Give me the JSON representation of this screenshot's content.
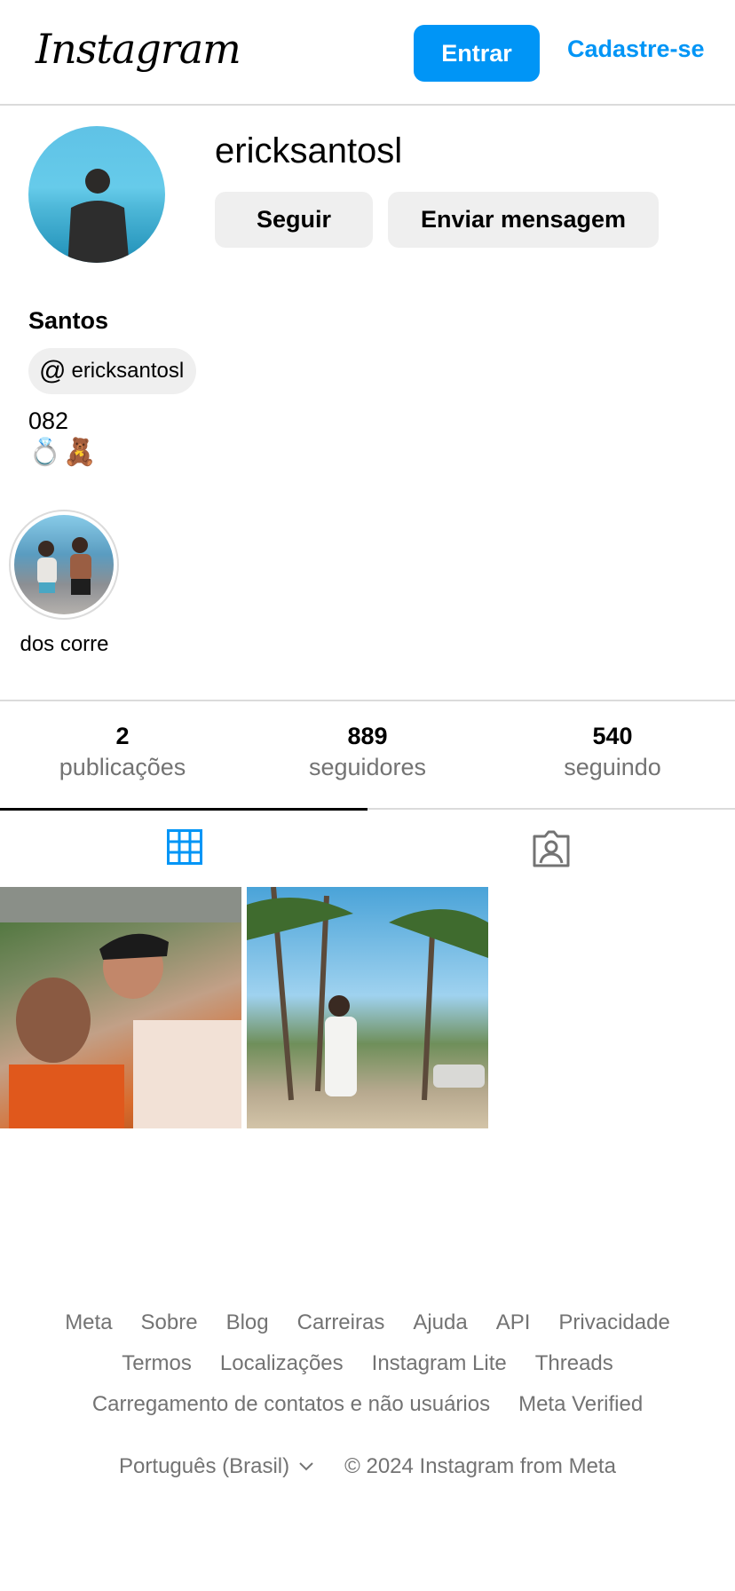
{
  "header": {
    "logo": "Instagram",
    "login_label": "Entrar",
    "signup_label": "Cadastre-se"
  },
  "profile": {
    "username": "ericksantosl",
    "follow_label": "Seguir",
    "message_label": "Enviar mensagem",
    "full_name": "Santos",
    "threads_handle": "ericksantosl",
    "bio_line": "082",
    "bio_emojis": [
      "💍",
      "🧸"
    ]
  },
  "highlights": [
    {
      "label": "dos corre"
    }
  ],
  "stats": [
    {
      "value": "2",
      "label": "publicações"
    },
    {
      "value": "889",
      "label": "seguidores"
    },
    {
      "value": "540",
      "label": "seguindo"
    }
  ],
  "tabs": {
    "active": "posts",
    "icons": [
      "grid-icon",
      "tagged-icon"
    ]
  },
  "colors": {
    "accent": "#0095f6",
    "secondary_text": "#737373",
    "button_bg": "#efefef",
    "divider": "#dbdbdb"
  },
  "footer": {
    "row1": [
      "Meta",
      "Sobre",
      "Blog",
      "Carreiras",
      "Ajuda",
      "API",
      "Privacidade"
    ],
    "row2": [
      "Termos",
      "Localizações",
      "Instagram Lite",
      "Threads"
    ],
    "row3": [
      "Carregamento de contatos e não usuários",
      "Meta Verified"
    ],
    "language": "Português (Brasil)",
    "copyright": "© 2024 Instagram from Meta"
  }
}
